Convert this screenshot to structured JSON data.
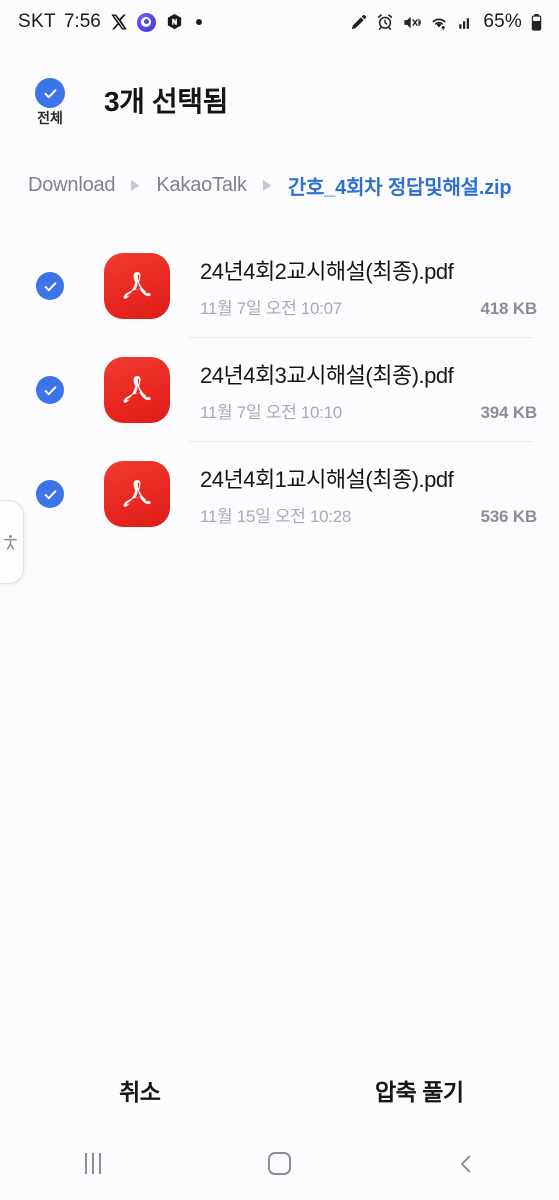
{
  "status_bar": {
    "carrier": "SKT",
    "time": "7:56",
    "battery_percent": "65%",
    "left_icons": [
      "x-twitter-icon",
      "chat-app-icon",
      "naver-app-icon",
      "dot-indicator-icon"
    ],
    "right_icons": [
      "pencil-icon",
      "alarm-clock-icon",
      "mute-vibrate-icon",
      "wifi-icon",
      "signal-bars-icon",
      "battery-icon"
    ]
  },
  "header": {
    "select_all_label": "전체",
    "title": "3개 선택됨"
  },
  "breadcrumb": {
    "items": [
      {
        "label": "Download",
        "active": false
      },
      {
        "label": "KakaoTalk",
        "active": false
      },
      {
        "label": "간호_4회차 정답및해설.zip",
        "active": true
      }
    ]
  },
  "files": [
    {
      "name": "24년4회2교시해설(최종).pdf",
      "date": "11월 7일 오전 10:07",
      "size": "418 KB",
      "selected": true,
      "icon": "pdf-file-icon"
    },
    {
      "name": "24년4회3교시해설(최종).pdf",
      "date": "11월 7일 오전 10:10",
      "size": "394 KB",
      "selected": true,
      "icon": "pdf-file-icon"
    },
    {
      "name": "24년4회1교시해설(최종).pdf",
      "date": "11월 15일 오전 10:28",
      "size": "536 KB",
      "selected": true,
      "icon": "pdf-file-icon"
    }
  ],
  "action_bar": {
    "cancel_label": "취소",
    "extract_label": "압축 풀기"
  },
  "nav_bar": {
    "recents_label": "recents-icon",
    "home_label": "home-icon",
    "back_label": "back-icon"
  },
  "accessibility_tab": {
    "icon": "accessibility-icon"
  },
  "colors": {
    "accent_blue": "#3c75e8",
    "breadcrumb_active": "#2f6fd0",
    "pdf_red": "#e8261f",
    "background": "#fcfcfe",
    "muted_text": "#a8abb4"
  }
}
